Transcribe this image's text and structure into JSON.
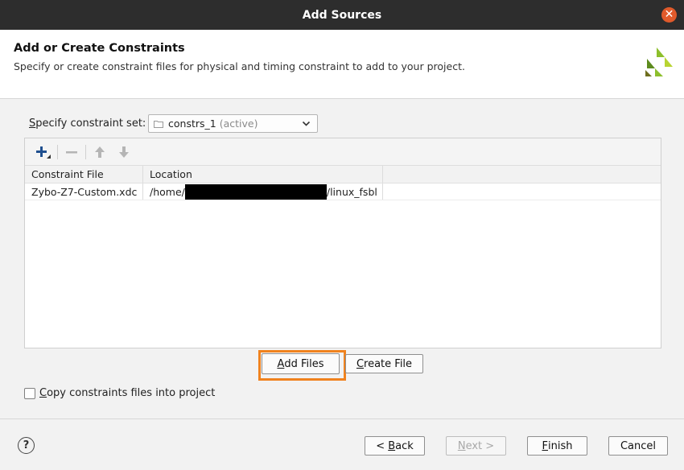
{
  "window": {
    "title": "Add Sources",
    "close_glyph": "✕"
  },
  "header": {
    "title": "Add or Create Constraints",
    "subtitle": "Specify or create constraint files for physical and timing constraint to add to your project."
  },
  "constraint_set": {
    "label_mnemonic": "S",
    "label_rest": "pecify constraint set:",
    "value": "constrs_1",
    "active_tag": "(active)"
  },
  "toolbar": {
    "icons": [
      "add-icon",
      "remove-icon",
      "move-up-icon",
      "move-down-icon"
    ]
  },
  "table": {
    "columns": [
      "Constraint File",
      "Location"
    ],
    "rows": [
      {
        "file": "Zybo-Z7-Custom.xdc",
        "location_prefix": "/home/",
        "location_suffix": "/linux_fsbl"
      }
    ]
  },
  "actions": {
    "add_files_mnemonic": "A",
    "add_files_rest": "dd Files",
    "create_file_mnemonic": "C",
    "create_file_rest": "reate File"
  },
  "copy_option": {
    "mnemonic": "C",
    "rest": "opy constraints files into project",
    "checked": false
  },
  "footer": {
    "help_glyph": "?",
    "back_pre": "< ",
    "back_mnemonic": "B",
    "back_rest": "ack",
    "next_mnemonic": "N",
    "next_rest": "ext >",
    "finish_mnemonic": "F",
    "finish_rest": "inish",
    "cancel": "Cancel"
  },
  "colors": {
    "highlight": "#f0821e",
    "title_bar": "#2d2d2d",
    "close": "#e05a2b",
    "add_icon": "#1f4f8f"
  }
}
